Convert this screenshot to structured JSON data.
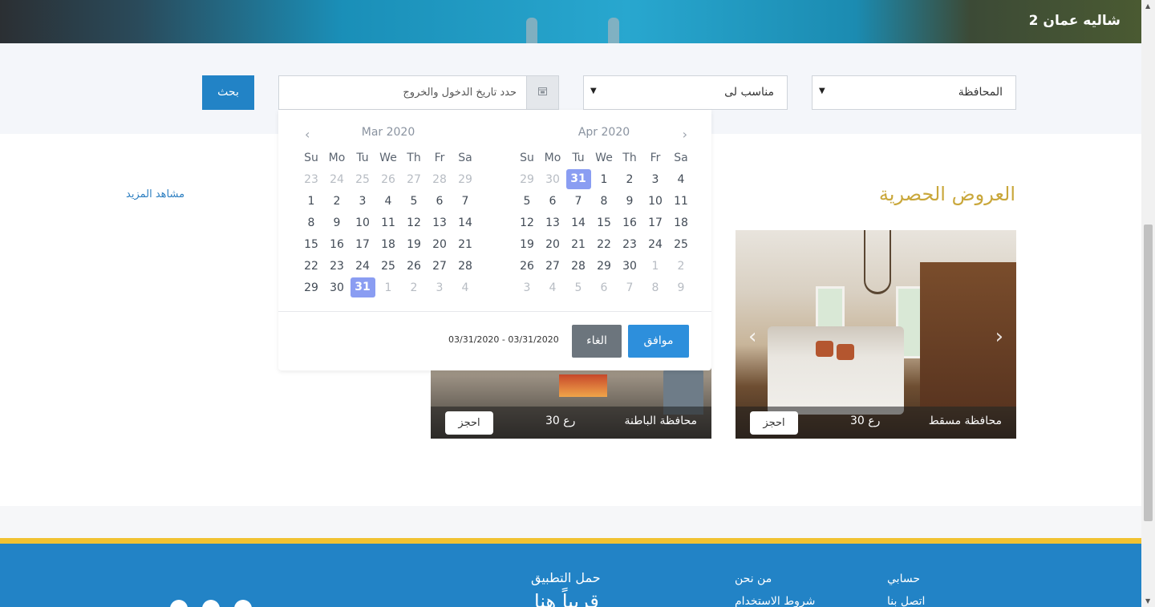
{
  "hero": {
    "title": "شاليه عمان 2"
  },
  "search": {
    "province_select": "المحافظة",
    "suitable_select": "مناسب لى",
    "date_placeholder": "حدد تاريخ الدخول والخروج",
    "search_button": "بحث"
  },
  "section": {
    "title": "العروض الحصرية",
    "more_link": "مشاهد المزيد"
  },
  "cards": [
    {
      "place": "محافظة مسقط",
      "price": "30 رع",
      "book": "احجز"
    },
    {
      "place": "محافظة الباطنة",
      "price": "30 رع",
      "book": "احجز"
    }
  ],
  "datepicker": {
    "weekdays": [
      "Su",
      "Mo",
      "Tu",
      "We",
      "Th",
      "Fr",
      "Sa"
    ],
    "left_month": {
      "title": "Mar 2020",
      "weeks": [
        [
          "23",
          "24",
          "25",
          "26",
          "27",
          "28",
          "29"
        ],
        [
          "1",
          "2",
          "3",
          "4",
          "5",
          "6",
          "7"
        ],
        [
          "8",
          "9",
          "10",
          "11",
          "12",
          "13",
          "14"
        ],
        [
          "15",
          "16",
          "17",
          "18",
          "19",
          "20",
          "21"
        ],
        [
          "22",
          "23",
          "24",
          "25",
          "26",
          "27",
          "28"
        ],
        [
          "29",
          "30",
          "31",
          "1",
          "2",
          "3",
          "4"
        ]
      ]
    },
    "right_month": {
      "title": "Apr 2020",
      "weeks": [
        [
          "29",
          "30",
          "31",
          "1",
          "2",
          "3",
          "4"
        ],
        [
          "5",
          "6",
          "7",
          "8",
          "9",
          "10",
          "11"
        ],
        [
          "12",
          "13",
          "14",
          "15",
          "16",
          "17",
          "18"
        ],
        [
          "19",
          "20",
          "21",
          "22",
          "23",
          "24",
          "25"
        ],
        [
          "26",
          "27",
          "28",
          "29",
          "30",
          "1",
          "2"
        ],
        [
          "3",
          "4",
          "5",
          "6",
          "7",
          "8",
          "9"
        ]
      ]
    },
    "range_text": "03/31/2020 - 03/31/2020",
    "cancel_label": "الغاء",
    "apply_label": "موافق"
  },
  "footer": {
    "account": "حسابي",
    "contact": "اتصل بنا",
    "about": "من نحن",
    "terms": "شروط الاستخدام",
    "app_title": "حمل التطبيق",
    "app_sub": "قريباً هنا"
  },
  "colors": {
    "primary": "#2283c6",
    "accent": "#c9a73b",
    "selected_day": "#8a9df2",
    "footer_line": "#f1c232"
  }
}
